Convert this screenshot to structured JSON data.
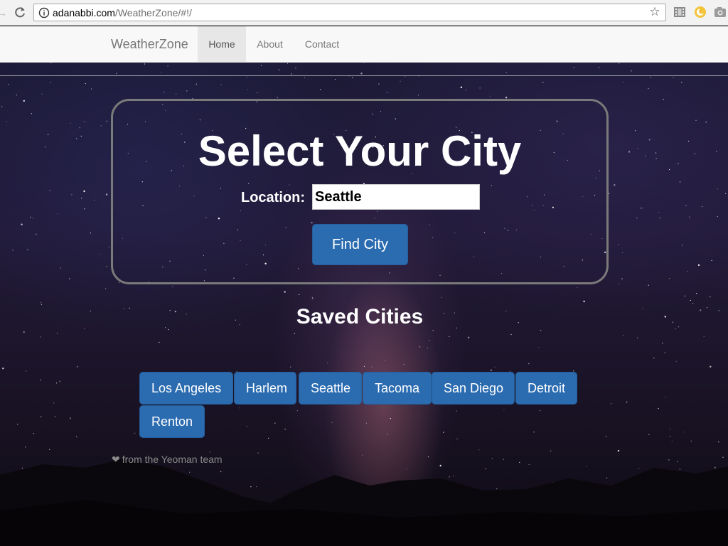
{
  "browser": {
    "url_host": "adanabbi.com",
    "url_path": "/WeatherZone/#!/",
    "icons": [
      "back-arrow-icon",
      "reload-icon",
      "info-icon",
      "star-icon",
      "film-extension-icon",
      "moon-extension-icon",
      "camera-extension-icon"
    ]
  },
  "navbar": {
    "brand": "WeatherZone",
    "items": [
      {
        "label": "Home",
        "active": true
      },
      {
        "label": "About",
        "active": false
      },
      {
        "label": "Contact",
        "active": false
      }
    ]
  },
  "search": {
    "title": "Select Your City",
    "location_label": "Location:",
    "location_value": "Seattle",
    "button_label": "Find City"
  },
  "saved": {
    "title": "Saved Cities",
    "cities": [
      "Los Angeles",
      "Harlem",
      "Seattle",
      "Tacoma",
      "San Diego",
      "Detroit",
      "Renton"
    ]
  },
  "footer": {
    "text": "from the Yeoman team",
    "icon": "heart-icon"
  },
  "colors": {
    "button": "#2b6bb0",
    "nav_active": "#e7e7e7",
    "card_border": "#7a7a7a"
  }
}
